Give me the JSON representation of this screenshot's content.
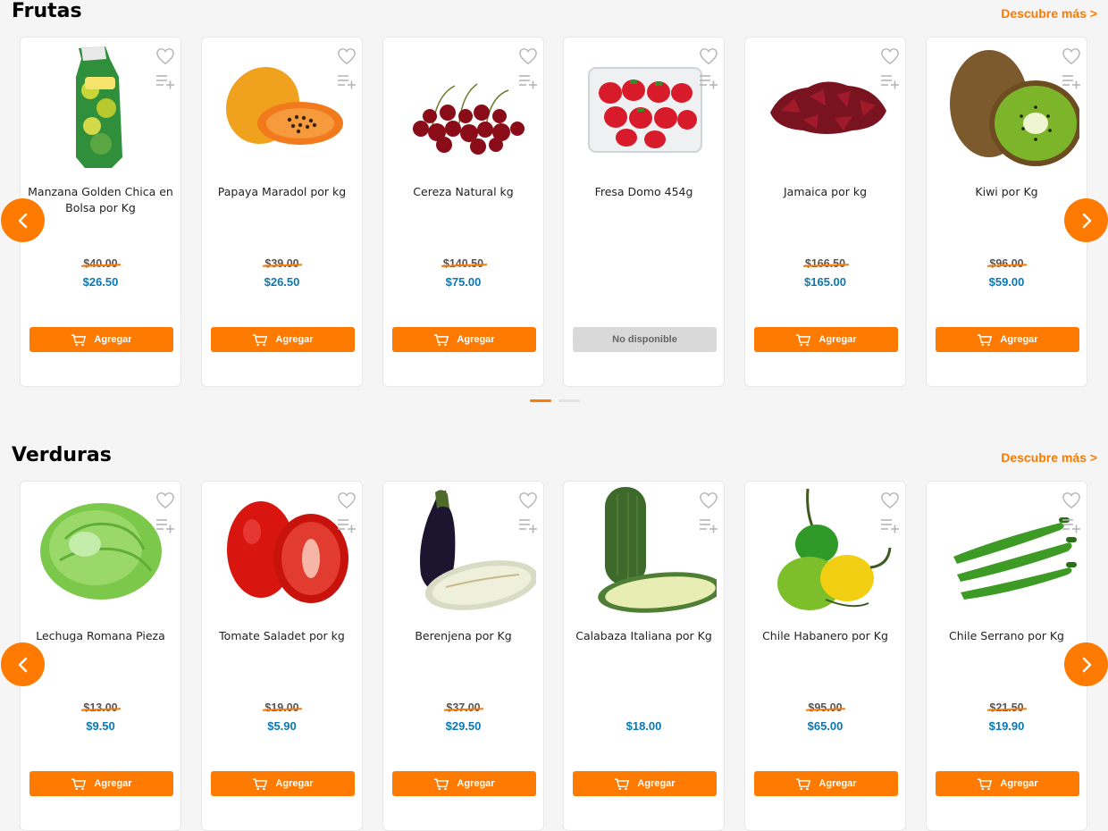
{
  "sections": [
    {
      "title": "Frutas",
      "more": "Descubre más >",
      "products": [
        {
          "name": "Manzana Golden Chica en Bolsa por Kg",
          "old": "$40.00",
          "price": "$26.50",
          "button": "Agregar",
          "available": true,
          "image": "apple-bag-image"
        },
        {
          "name": "Papaya Maradol por kg",
          "old": "$39.00",
          "price": "$26.50",
          "button": "Agregar",
          "available": true,
          "image": "papaya-image"
        },
        {
          "name": "Cereza Natural kg",
          "old": "$140.50",
          "price": "$75.00",
          "button": "Agregar",
          "available": true,
          "image": "cherries-image"
        },
        {
          "name": "Fresa Domo 454g",
          "old": "",
          "price": "",
          "button": "No disponible",
          "available": false,
          "image": "strawberries-image"
        },
        {
          "name": "Jamaica por kg",
          "old": "$166.50",
          "price": "$165.00",
          "button": "Agregar",
          "available": true,
          "image": "hibiscus-image"
        },
        {
          "name": "Kiwi por Kg",
          "old": "$96.00",
          "price": "$59.00",
          "button": "Agregar",
          "available": true,
          "image": "kiwi-image"
        }
      ]
    },
    {
      "title": "Verduras",
      "more": "Descubre más >",
      "products": [
        {
          "name": "Lechuga Romana Pieza",
          "old": "$13.00",
          "price": "$9.50",
          "button": "Agregar",
          "available": true,
          "image": "lettuce-image"
        },
        {
          "name": "Tomate Saladet por kg",
          "old": "$19.00",
          "price": "$5.90",
          "button": "Agregar",
          "available": true,
          "image": "tomato-image"
        },
        {
          "name": "Berenjena por Kg",
          "old": "$37.00",
          "price": "$29.50",
          "button": "Agregar",
          "available": true,
          "image": "eggplant-image"
        },
        {
          "name": "Calabaza Italiana por Kg",
          "old": "",
          "price": "$18.00",
          "button": "Agregar",
          "available": true,
          "image": "zucchini-image"
        },
        {
          "name": "Chile Habanero por Kg",
          "old": "$95.00",
          "price": "$65.00",
          "button": "Agregar",
          "available": true,
          "image": "habanero-image"
        },
        {
          "name": "Chile Serrano por Kg",
          "old": "$21.50",
          "price": "$19.90",
          "button": "Agregar",
          "available": true,
          "image": "serrano-image"
        }
      ]
    }
  ],
  "carousel": {
    "pages": 2,
    "active": 0
  },
  "colors": {
    "accent": "#ff7a00",
    "price": "#0a78b5",
    "unavailable": "#d9d9d9"
  }
}
